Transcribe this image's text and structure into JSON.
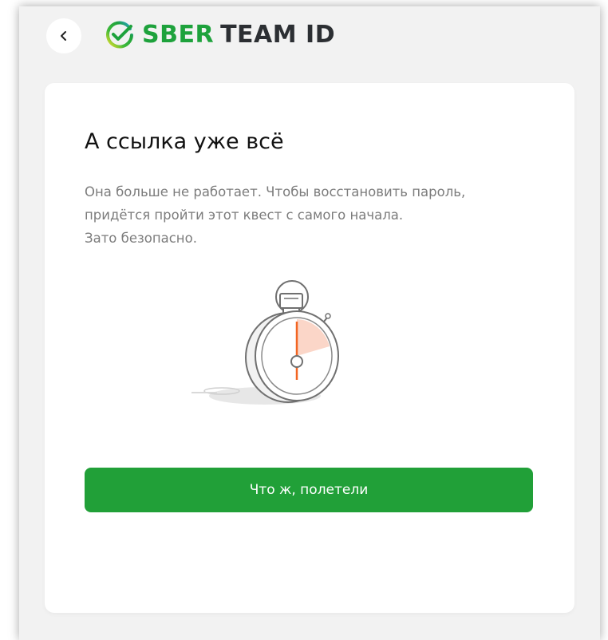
{
  "header": {
    "back_icon": "chevron-left-icon",
    "logo_icon": "sber-checkmark-logo-icon",
    "brand_text": "SBER",
    "product_text": "TEAM ID"
  },
  "card": {
    "title": "А ссылка уже всё",
    "description_lines": [
      "Она больше не работает. Чтобы восстановить пароль,",
      "придётся пройти этот квест с самого начала.",
      "Зато безопасно."
    ],
    "illustration": "stopwatch-illustration",
    "button_label": "Что ж, полетели"
  },
  "colors": {
    "brand_green": "#21A038",
    "page_background": "#F2F2F2",
    "card_background": "#FFFFFF",
    "title_text": "#111111",
    "body_text": "#7C7C7C",
    "stopwatch_accent": "#F26522"
  }
}
